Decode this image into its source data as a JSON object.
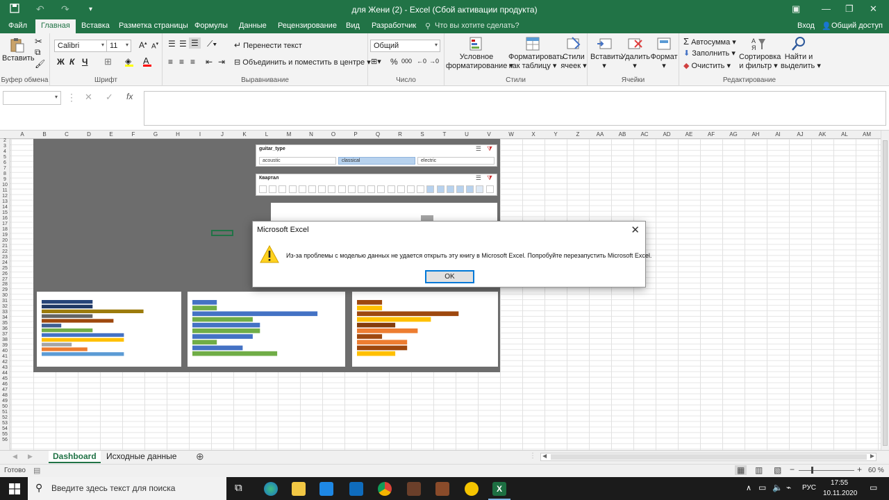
{
  "window": {
    "title": "для Жени (2) - Excel (Сбой активации продукта)"
  },
  "tabs": [
    {
      "label": "Файл"
    },
    {
      "label": "Главная"
    },
    {
      "label": "Вставка"
    },
    {
      "label": "Разметка страницы"
    },
    {
      "label": "Формулы"
    },
    {
      "label": "Данные"
    },
    {
      "label": "Рецензирование"
    },
    {
      "label": "Вид"
    },
    {
      "label": "Разработчик"
    }
  ],
  "tellme": "Что вы хотите сделать?",
  "signin": "Вход",
  "share": "Общий доступ",
  "ribbon": {
    "paste": "Вставить",
    "clipboard": "Буфер обмена",
    "font_name": "Calibri",
    "font_size": "11",
    "font_group": "Шрифт",
    "bold": "Ж",
    "italic": "К",
    "underline": "Ч",
    "wrap_text": "Перенести текст",
    "merge_center": "Объединить и поместить в центре",
    "alignment": "Выравнивание",
    "number_format": "Общий",
    "number_group": "Число",
    "cond_format_1": "Условное",
    "cond_format_2": "форматирование",
    "format_table_1": "Форматировать",
    "format_table_2": "как таблицу",
    "cell_styles_1": "Стили",
    "cell_styles_2": "ячеек",
    "styles_group": "Стили",
    "insert": "Вставить",
    "delete": "Удалить",
    "format": "Формат",
    "cells_group": "Ячейки",
    "autosum": "Автосумма",
    "fill": "Заполнить",
    "clear": "Очистить",
    "sort_1": "Сортировка",
    "sort_2": "и фильтр",
    "find_1": "Найти и",
    "find_2": "выделить",
    "editing_group": "Редактирование"
  },
  "columns": [
    "A",
    "B",
    "C",
    "D",
    "E",
    "F",
    "G",
    "H",
    "I",
    "J",
    "K",
    "L",
    "M",
    "N",
    "O",
    "P",
    "Q",
    "R",
    "S",
    "T",
    "U",
    "V",
    "W",
    "X",
    "Y",
    "Z",
    "AA",
    "AB",
    "AC",
    "AD",
    "AE",
    "AF",
    "AG",
    "AH",
    "AI",
    "AJ",
    "AK",
    "AL",
    "AM"
  ],
  "rows": [
    "2",
    "3",
    "4",
    "5",
    "6",
    "7",
    "8",
    "9",
    "10",
    "11",
    "12",
    "13",
    "14",
    "15",
    "16",
    "17",
    "18",
    "19",
    "20",
    "21",
    "22",
    "23",
    "24",
    "25",
    "26",
    "27",
    "28",
    "29",
    "30",
    "31",
    "32",
    "33",
    "34",
    "35",
    "36",
    "37",
    "38",
    "39",
    "40",
    "41",
    "42",
    "43",
    "44",
    "45",
    "46",
    "47",
    "48",
    "49",
    "50",
    "51",
    "52",
    "53",
    "54",
    "55",
    "56"
  ],
  "slicer_guitar": {
    "title": "guitar_type",
    "items": [
      {
        "label": "acoustic",
        "selected": false
      },
      {
        "label": "classical",
        "selected": true
      },
      {
        "label": "electric",
        "selected": false
      }
    ]
  },
  "slicer_quarter": {
    "title": "Квартал"
  },
  "charts": [
    {
      "bars": [
        {
          "w": 0.39,
          "c": "#264478"
        },
        {
          "w": 0.39,
          "c": "#1f3864"
        },
        {
          "w": 0.78,
          "c": "#9c7b0c"
        },
        {
          "w": 0.39,
          "c": "#636363"
        },
        {
          "w": 0.55,
          "c": "#9e480e"
        },
        {
          "w": 0.15,
          "c": "#3e5d91"
        },
        {
          "w": 0.39,
          "c": "#70ad47"
        },
        {
          "w": 0.63,
          "c": "#4472c4"
        },
        {
          "w": 0.63,
          "c": "#ffc000"
        },
        {
          "w": 0.23,
          "c": "#a5a5a5"
        },
        {
          "w": 0.35,
          "c": "#ed7d31"
        },
        {
          "w": 0.63,
          "c": "#5b9bd5"
        }
      ]
    },
    {
      "bars": [
        {
          "w": 0.17,
          "c": "#4472c4"
        },
        {
          "w": 0.17,
          "c": "#70ad47"
        },
        {
          "w": 0.87,
          "c": "#4472c4"
        },
        {
          "w": 0.42,
          "c": "#70ad47"
        },
        {
          "w": 0.47,
          "c": "#4472c4"
        },
        {
          "w": 0.47,
          "c": "#70ad47"
        },
        {
          "w": 0.42,
          "c": "#4472c4"
        },
        {
          "w": 0.17,
          "c": "#70ad47"
        },
        {
          "w": 0.35,
          "c": "#4472c4"
        },
        {
          "w": 0.59,
          "c": "#70ad47"
        }
      ]
    },
    {
      "bars": [
        {
          "w": 0.19,
          "c": "#9e480e"
        },
        {
          "w": 0.19,
          "c": "#ffc000"
        },
        {
          "w": 0.77,
          "c": "#9e480e"
        },
        {
          "w": 0.56,
          "c": "#ffc000"
        },
        {
          "w": 0.29,
          "c": "#843c0c"
        },
        {
          "w": 0.46,
          "c": "#ed7d31"
        },
        {
          "w": 0.19,
          "c": "#9e480e"
        },
        {
          "w": 0.38,
          "c": "#ed7d31"
        },
        {
          "w": 0.38,
          "c": "#9e480e"
        },
        {
          "w": 0.29,
          "c": "#ffc000"
        }
      ]
    }
  ],
  "dialog": {
    "title": "Microsoft Excel",
    "message": "Из-за проблемы с моделью данных не удается открыть эту книгу в Microsoft Excel. Попробуйте перезапустить Microsoft Excel.",
    "ok": "OK"
  },
  "sheets": [
    {
      "label": "Dashboard",
      "active": true
    },
    {
      "label": "Исходные данные",
      "active": false
    }
  ],
  "status": {
    "ready": "Готово",
    "zoom": "60 %"
  },
  "taskbar": {
    "search": "Введите здесь текст для поиска",
    "lang": "РУС",
    "time": "17:55",
    "date": "10.11.2020"
  }
}
